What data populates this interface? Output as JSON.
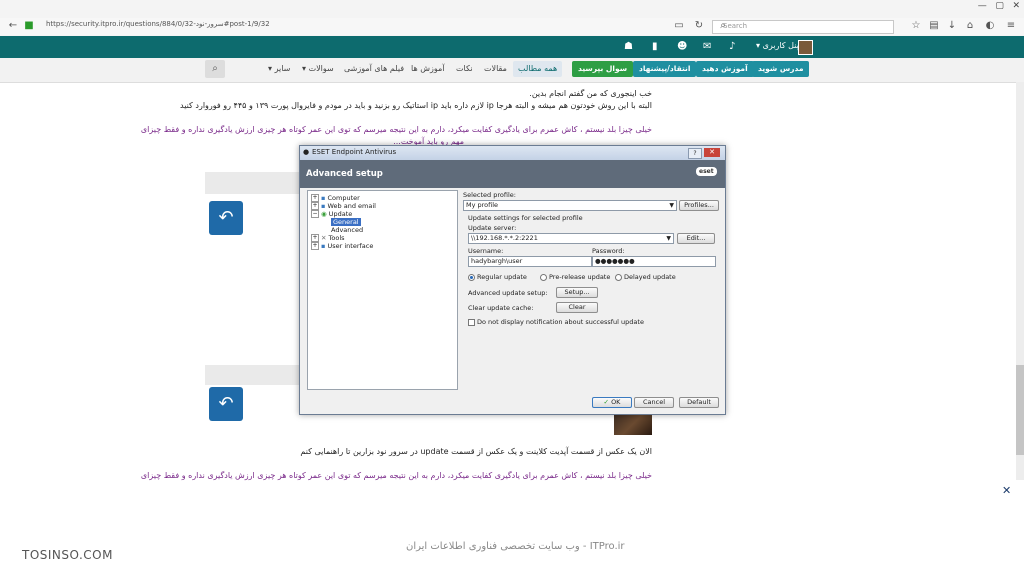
{
  "browser": {
    "url": "https://security.itpro.ir/questions/884/0/32-سرور-نود#post-1/9/32",
    "search_placeholder": "Search",
    "window_controls": [
      "—",
      "▢",
      "✕"
    ]
  },
  "header": {
    "user_panel_label": "▾ پنل کاربری"
  },
  "nav": {
    "buttons": [
      "مدرس شوید",
      "آموزش دهید",
      "انتقاد/پیشنهاد",
      "سوال بپرسید"
    ],
    "button_colors": [
      "#1f8fa0",
      "#1f8fa0",
      "#1f8fa0",
      "#2e9e44"
    ],
    "active": "همه مطالب",
    "links": [
      "مقالات",
      "نکات",
      "آموزش ها",
      "فیلم های آموزشی",
      "▾ سوالات",
      "▾ سایر"
    ]
  },
  "posts": {
    "p1_line1": "خب اینجوری که من گفتم انجام بدین.",
    "p1_line2": "البته با این روش خودتون هم میشه و البته هرجا ip لازم داره باید ip استاتیک رو بزنید و باید در مودم و فایروال پورت ۱۳۹ و ۴۴۵ رو فوروارد کنید",
    "p1_sig1": "خیلی چیزا بلد نیستم ، کاش عمرم برای یادگیری کفایت میکرد، دارم به این نتیجه میرسم که توی این عمر کوتاه هر چیزی ارزش یادگیری نداره و فقط چیزای",
    "p1_sig2": "مهم رو باید آموخت...",
    "p2_line1": "الان یک عکس از قسمت آپدیت کلاینت و یک عکس از قسمت update در سرور نود بزارین تا راهنمایی کنم",
    "p2_sig1": "خیلی چیزا بلد نیستم ، کاش عمرم برای یادگیری کفایت میکرد، دارم به این نتیجه میرسم که توی این عمر کوتاه هر چیزی ارزش یادگیری نداره و فقط چیزای"
  },
  "eset": {
    "window_title": "ESET Endpoint Antivirus",
    "header_title": "Advanced setup",
    "logo": "eset",
    "tree": [
      "Computer",
      "Web and email",
      "Update",
      "General",
      "Advanced",
      "Tools",
      "User interface"
    ],
    "selected_profile_label": "Selected profile:",
    "selected_profile_value": "My profile",
    "profiles_button": "Profiles...",
    "update_settings_label": "Update settings for selected profile",
    "update_server_label": "Update server:",
    "update_server_value": "\\\\192.168.*.*.2:2221",
    "edit_button": "Edit...",
    "username_label": "Username:",
    "username_value": "hadybargh\\user",
    "password_label": "Password:",
    "password_value": "●●●●●●●",
    "radio_regular": "Regular update",
    "radio_prerelease": "Pre-release update",
    "radio_delayed": "Delayed update",
    "advanced_update_label": "Advanced update setup:",
    "setup_button": "Setup...",
    "clear_cache_label": "Clear update cache:",
    "clear_button": "Clear",
    "notify_checkbox": "Do not display notification about successful update",
    "ok_button": "OK",
    "cancel_button": "Cancel",
    "default_button": "Default"
  },
  "footer": {
    "brand_left": "TOSINSO.COM",
    "brand_center": "ITPro.ir - وب سایت تخصصی فناوری اطلاعات ایران"
  }
}
